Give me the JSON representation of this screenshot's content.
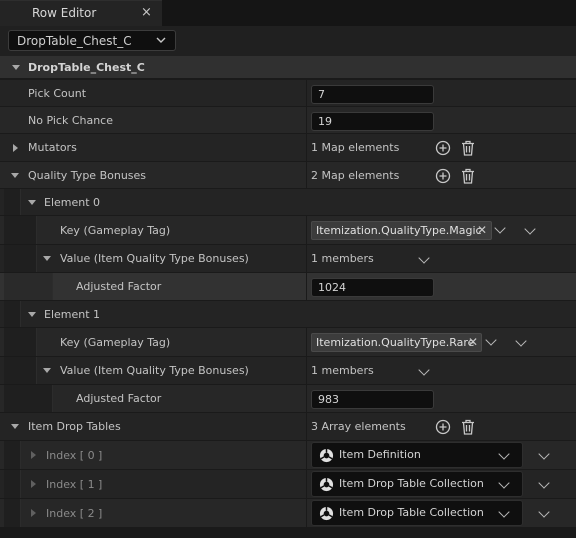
{
  "tab": {
    "title": "Row Editor",
    "close": "×"
  },
  "row_select": {
    "value": "DropTable_Chest_C"
  },
  "section": {
    "title": "DropTable_Chest_C"
  },
  "pick_count": {
    "label": "Pick Count",
    "value": "7"
  },
  "no_pick_chance": {
    "label": "No Pick Chance",
    "value": "19"
  },
  "mutators": {
    "label": "Mutators",
    "summary": "1 Map elements"
  },
  "quality_bonuses": {
    "label": "Quality Type Bonuses",
    "summary": "2 Map elements",
    "elements": [
      {
        "label": "Element 0",
        "key_label": "Key (Gameplay Tag)",
        "tag": "Itemization.QualityType.Magic",
        "value_label": "Value (Item Quality Type Bonuses)",
        "members": "1 members",
        "factor_label": "Adjusted Factor",
        "factor_value": "1024"
      },
      {
        "label": "Element 1",
        "key_label": "Key (Gameplay Tag)",
        "tag": "Itemization.QualityType.Rare",
        "value_label": "Value (Item Quality Type Bonuses)",
        "members": "1 members",
        "factor_label": "Adjusted Factor",
        "factor_value": "983"
      }
    ]
  },
  "item_drop_tables": {
    "label": "Item Drop Tables",
    "summary": "3 Array elements",
    "items": [
      {
        "index": "Index [ 0 ]",
        "asset": "Item Definition"
      },
      {
        "index": "Index [ 1 ]",
        "asset": "Item Drop Table Collection"
      },
      {
        "index": "Index [ 2 ]",
        "asset": "Item Drop Table Collection"
      }
    ]
  },
  "colors": {
    "background": "#1a1a1a",
    "category": "#303030",
    "row": "#242424",
    "text": "#c4c4c4"
  }
}
